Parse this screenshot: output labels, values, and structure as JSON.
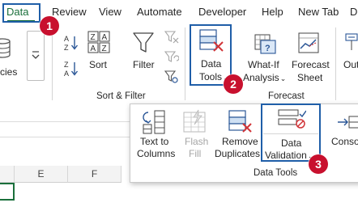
{
  "tabs": [
    {
      "label": "Data",
      "active": true
    },
    {
      "label": "Review"
    },
    {
      "label": "View"
    },
    {
      "label": "Automate"
    },
    {
      "label": "Developer"
    },
    {
      "label": "Help"
    },
    {
      "label": "New Tab"
    },
    {
      "label": "D"
    }
  ],
  "ribbon": {
    "left_partial_label": "cies",
    "sort_label": "Sort",
    "filter_label": "Filter",
    "sort_filter_group": "Sort & Filter",
    "data_tools_label_1": "Data",
    "data_tools_label_2": "Tools",
    "what_if_label_1": "What-If",
    "what_if_label_2": "Analysis",
    "forecast_sheet_label_1": "Forecast",
    "forecast_sheet_label_2": "Sheet",
    "forecast_group": "Forecast",
    "outline_partial_label": "Out"
  },
  "popout": {
    "text_to_columns_1": "Text to",
    "text_to_columns_2": "Columns",
    "flash_fill_1": "Flash",
    "flash_fill_2": "Fill",
    "remove_duplicates_1": "Remove",
    "remove_duplicates_2": "Duplicates",
    "data_validation_1": "Data",
    "data_validation_2": "Validation",
    "consolidate_partial": "Consolid",
    "group_label": "Data Tools"
  },
  "sheet": {
    "columns": [
      "E",
      "F"
    ]
  },
  "badges": [
    "1",
    "2",
    "3"
  ],
  "colors": {
    "accent_green": "#1a6f3b",
    "highlight_blue": "#1f5ea8",
    "badge_red": "#c8102e"
  }
}
